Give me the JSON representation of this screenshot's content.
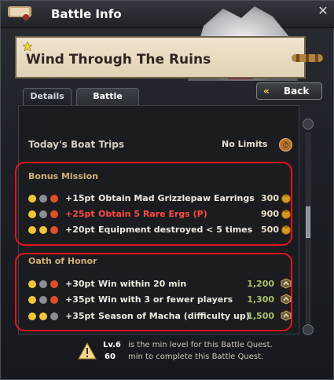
{
  "window": {
    "title": "Battle Info",
    "close": "✕"
  },
  "banner": {
    "title": "Wind Through The Ruins"
  },
  "tabs": [
    {
      "label": "Details"
    },
    {
      "label": "Battle Points"
    }
  ],
  "back_button": {
    "chevron": "«",
    "label": "Back"
  },
  "trips": {
    "label": "Today's Boat Trips",
    "value": "No Limits"
  },
  "bonus": {
    "title": "Bonus Mission",
    "rows": [
      {
        "points": "+15pt",
        "text": "Obtain Mad Grizzlepaw Earrings",
        "value": "300"
      },
      {
        "points": "+25pt",
        "text": "Obtain 5 Rare Ergs (P)",
        "value": "900"
      },
      {
        "points": "+20pt",
        "text": "Equipment destroyed < 5 times",
        "value": "500"
      }
    ]
  },
  "oath": {
    "title": "Oath of Honor",
    "rows": [
      {
        "points": "+30pt",
        "text": "Win within 20 min",
        "value": "1,200"
      },
      {
        "points": "+35pt",
        "text": "Win with 3 or fewer players",
        "value": "1,300"
      },
      {
        "points": "+35pt",
        "text": "Season of Macha (difficulty up)",
        "value": "1,500"
      }
    ]
  },
  "footer": {
    "level": "Lv.6",
    "minutes": "60",
    "line1": "is the min level for this Battle Quest.",
    "line2": "min to complete this Battle Quest."
  }
}
